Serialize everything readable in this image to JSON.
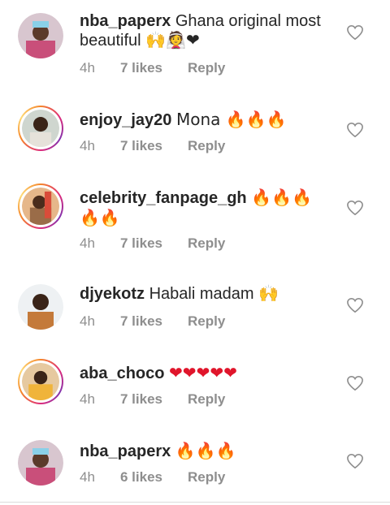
{
  "colors": {
    "story_ring": "#dd2a7b",
    "meta": "#8e8e8e",
    "text": "#262626"
  },
  "comments": [
    {
      "username": "nba_paperx",
      "text": "Ghana original most beautiful 🙌👰❤",
      "time": "4h",
      "likes": "7 likes",
      "reply": "Reply",
      "story": false
    },
    {
      "username": "enjoy_jay20",
      "text": "Mona 🔥🔥🔥",
      "time": "4h",
      "likes": "7 likes",
      "reply": "Reply",
      "story": true
    },
    {
      "username": "celebrity_fanpage_gh",
      "text": "🔥🔥🔥🔥🔥",
      "time": "4h",
      "likes": "7 likes",
      "reply": "Reply",
      "story": true
    },
    {
      "username": "djyekotz",
      "text": "Habali madam 🙌",
      "time": "4h",
      "likes": "7 likes",
      "reply": "Reply",
      "story": false
    },
    {
      "username": "aba_choco",
      "text": "❤❤❤❤❤",
      "time": "4h",
      "likes": "7 likes",
      "reply": "Reply",
      "story": true
    },
    {
      "username": "nba_paperx",
      "text": "🔥🔥🔥",
      "time": "4h",
      "likes": "6 likes",
      "reply": "Reply",
      "story": false
    }
  ]
}
